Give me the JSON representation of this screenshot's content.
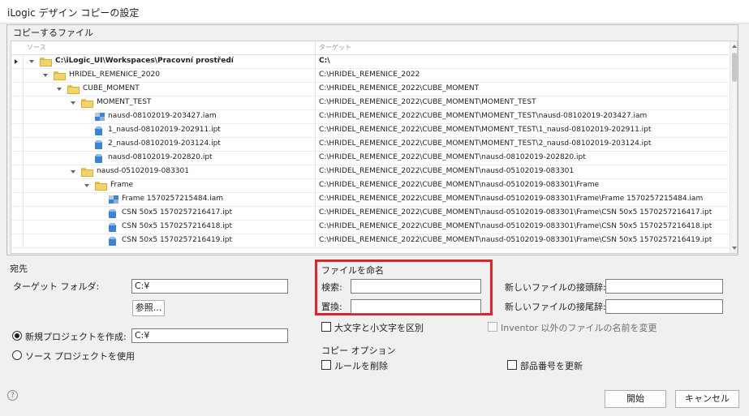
{
  "window": {
    "title": "iLogic デザイン コピーの設定"
  },
  "files_group": {
    "legend": "コピーするファイル",
    "columns": {
      "source": "ソース",
      "target": "ターゲット"
    },
    "rows": [
      {
        "source": "C:\\iLogic_UI\\Workspaces\\Pracovní prostředí",
        "target": "C:\\",
        "icon": "folder-icon",
        "level": 0,
        "expanded": true,
        "bold": true,
        "current": true
      },
      {
        "source": "HRIDEL_REMENICE_2020",
        "target": "C:\\HRIDEL_REMENICE_2022",
        "icon": "folder-icon",
        "level": 1,
        "expanded": true
      },
      {
        "source": "CUBE_MOMENT",
        "target": "C:\\HRIDEL_REMENICE_2022\\CUBE_MOMENT",
        "icon": "folder-icon",
        "level": 2,
        "expanded": true
      },
      {
        "source": "MOMENT_TEST",
        "target": "C:\\HRIDEL_REMENICE_2022\\CUBE_MOMENT\\MOMENT_TEST",
        "icon": "folder-icon",
        "level": 3,
        "expanded": true
      },
      {
        "source": "nausd-08102019-203427.iam",
        "target": "C:\\HRIDEL_REMENICE_2022\\CUBE_MOMENT\\MOMENT_TEST\\nausd-08102019-203427.iam",
        "icon": "assembly-icon",
        "level": 4
      },
      {
        "source": "1_nausd-08102019-202911.ipt",
        "target": "C:\\HRIDEL_REMENICE_2022\\CUBE_MOMENT\\MOMENT_TEST\\1_nausd-08102019-202911.ipt",
        "icon": "part-icon",
        "level": 4
      },
      {
        "source": "2_nausd-08102019-203124.ipt",
        "target": "C:\\HRIDEL_REMENICE_2022\\CUBE_MOMENT\\MOMENT_TEST\\2_nausd-08102019-203124.ipt",
        "icon": "part-icon",
        "level": 4
      },
      {
        "source": "nausd-08102019-202820.ipt",
        "target": "C:\\HRIDEL_REMENICE_2022\\CUBE_MOMENT\\nausd-08102019-202820.ipt",
        "icon": "part-icon",
        "level": 4
      },
      {
        "source": "nausd-05102019-083301",
        "target": "C:\\HRIDEL_REMENICE_2022\\CUBE_MOMENT\\nausd-05102019-083301",
        "icon": "folder-icon",
        "level": 3,
        "expanded": true
      },
      {
        "source": "Frame",
        "target": "C:\\HRIDEL_REMENICE_2022\\CUBE_MOMENT\\nausd-05102019-083301\\Frame",
        "icon": "folder-icon",
        "level": 4,
        "expanded": true
      },
      {
        "source": "Frame 1570257215484.iam",
        "target": "C:\\HRIDEL_REMENICE_2022\\CUBE_MOMENT\\nausd-05102019-083301\\Frame\\Frame 1570257215484.iam",
        "icon": "assembly-icon",
        "level": 5
      },
      {
        "source": "CSN 50x5 1570257216417.ipt",
        "target": "C:\\HRIDEL_REMENICE_2022\\CUBE_MOMENT\\nausd-05102019-083301\\Frame\\CSN 50x5 1570257216417.ipt",
        "icon": "part-icon",
        "level": 5
      },
      {
        "source": "CSN 50x5 1570257216418.ipt",
        "target": "C:\\HRIDEL_REMENICE_2022\\CUBE_MOMENT\\nausd-05102019-083301\\Frame\\CSN 50x5 1570257216418.ipt",
        "icon": "part-icon",
        "level": 5
      },
      {
        "source": "CSN 50x5 1570257216419.ipt",
        "target": "C:\\HRIDEL_REMENICE_2022\\CUBE_MOMENT\\nausd-05102019-083301\\Frame\\CSN 50x5 1570257216419.ipt",
        "icon": "part-icon",
        "level": 5
      }
    ]
  },
  "destination": {
    "heading": "宛先",
    "target_folder_label": "ターゲット フォルダ:",
    "target_folder_value": "C:¥",
    "browse_label": "参照...",
    "new_project_label": "新規プロジェクトを作成:",
    "new_project_value": "C:¥",
    "new_project_selected": true,
    "source_project_label": "ソース プロジェクトを使用"
  },
  "naming": {
    "heading": "ファイルを命名",
    "search_label": "検索:",
    "search_value": "",
    "replace_label": "置換:",
    "replace_value": "",
    "case_sensitive_label": "大文字と小文字を区別",
    "prefix_label": "新しいファイルの接頭辞:",
    "prefix_value": "",
    "suffix_label": "新しいファイルの接尾辞:",
    "suffix_value": "",
    "rename_non_inventor_label": "Inventor 以外のファイルの名前を変更"
  },
  "copy_options": {
    "heading": "コピー オプション",
    "delete_rules_label": "ルールを削除",
    "update_part_number_label": "部品番号を更新"
  },
  "footer": {
    "help_glyph": "?",
    "start_label": "開始",
    "cancel_label": "キャンセル"
  },
  "colors": {
    "highlight_box": "#d9252b"
  }
}
